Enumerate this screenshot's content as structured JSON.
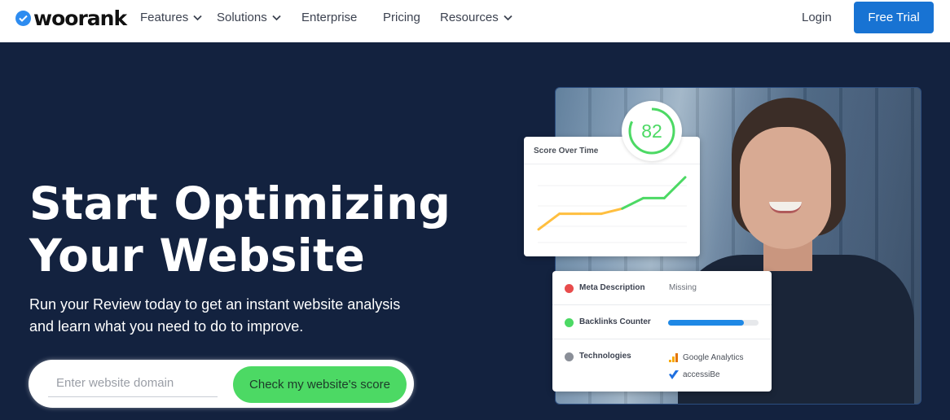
{
  "nav": {
    "logo_text": "woorank",
    "items": [
      {
        "label": "Features",
        "has_dropdown": true
      },
      {
        "label": "Solutions",
        "has_dropdown": true
      },
      {
        "label": "Enterprise",
        "has_dropdown": false
      },
      {
        "label": "Pricing",
        "has_dropdown": false
      },
      {
        "label": "Resources",
        "has_dropdown": true
      }
    ],
    "login_label": "Login",
    "free_trial_label": "Free Trial"
  },
  "hero": {
    "title_line1": "Start Optimizing",
    "title_line2": "Your Website",
    "subtitle": "Run your Review today to get an instant website analysis and learn what you need to do to improve.",
    "search_placeholder": "Enter website domain",
    "search_value": "",
    "cta_label": "Check my website's score"
  },
  "score_card": {
    "title": "Score Over Time",
    "score": "82",
    "score_fraction": 0.82,
    "trend_points": [
      22,
      34,
      34,
      34,
      38,
      46,
      46,
      62
    ],
    "colors": {
      "low": "#e84c4c",
      "mid": "#ffbf3f",
      "high": "#4cd964"
    }
  },
  "audit_card": {
    "rows": [
      {
        "label": "Meta Description",
        "status": "error",
        "value": "Missing"
      },
      {
        "label": "Backlinks Counter",
        "status": "ok",
        "progress": 0.84
      },
      {
        "label": "Technologies",
        "status": "info",
        "technologies": [
          "Google Analytics",
          "accessiBe"
        ]
      }
    ],
    "colors": {
      "error": "#e84c4c",
      "ok": "#4cd964",
      "info": "#8a8f98",
      "progress": "#1e88e5"
    }
  },
  "colors": {
    "nav_bg": "#ffffff",
    "hero_bg": "#13223f",
    "primary": "#1873d3",
    "cta": "#4cd964"
  }
}
